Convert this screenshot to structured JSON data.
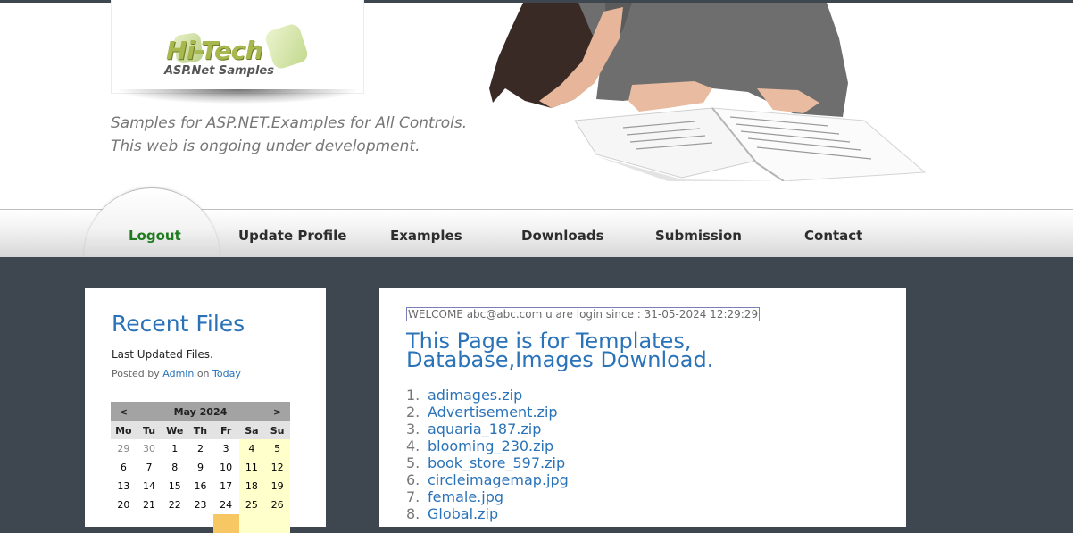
{
  "header": {
    "logo_title": "Hi-Tech",
    "logo_subtitle": "ASP.Net Samples",
    "tagline_line1": "Samples for ASP.NET.Examples for All Controls.",
    "tagline_line2": "This web is ongoing under development."
  },
  "nav": {
    "items": [
      {
        "label": "Logout",
        "active": true
      },
      {
        "label": "Update Profile"
      },
      {
        "label": "Examples"
      },
      {
        "label": "Downloads"
      },
      {
        "label": "Submission"
      },
      {
        "label": "Contact"
      }
    ]
  },
  "sidebar": {
    "title": "Recent Files",
    "description": "Last Updated Files.",
    "posted_by_prefix": "Posted by",
    "author": "Admin",
    "on_word": "on",
    "date_link": "Today",
    "calendar": {
      "prev": "<",
      "next": ">",
      "month": "May 2024",
      "days_of_week": [
        "Mo",
        "Tu",
        "We",
        "Th",
        "Fr",
        "Sa",
        "Su"
      ],
      "weeks": [
        [
          "29",
          "30",
          "1",
          "2",
          "3",
          "4",
          "5"
        ],
        [
          "6",
          "7",
          "8",
          "9",
          "10",
          "11",
          "12"
        ],
        [
          "13",
          "14",
          "15",
          "16",
          "17",
          "18",
          "19"
        ],
        [
          "20",
          "21",
          "22",
          "23",
          "24",
          "25",
          "26"
        ]
      ]
    }
  },
  "main": {
    "welcome": "WELCOME abc@abc.com u are login since : 31-05-2024 12:29:29",
    "title": "This Page is for Templates, Database,Images Download.",
    "files": [
      "adimages.zip",
      "Advertisement.zip",
      "aquaria_187.zip",
      "blooming_230.zip",
      "book_store_597.zip",
      "circleimagemap.jpg",
      "female.jpg",
      "Global.zip"
    ]
  },
  "colors": {
    "page_bg": "#3e474f",
    "link_blue": "#2a73b8",
    "active_nav": "#1f7b1f",
    "weekend_bg": "#ffffcc",
    "today_bg": "#f7c764"
  }
}
